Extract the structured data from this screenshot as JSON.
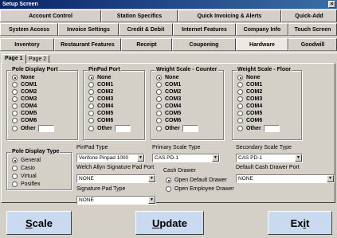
{
  "window": {
    "title": "Setup Screen",
    "close_label": "×"
  },
  "tabs": {
    "row1": [
      "Account Control",
      "Station Specifics",
      "Quick Invoicing & Alerts",
      "Quick-Add"
    ],
    "row2": [
      "System Access",
      "Invoice Settings",
      "Credit & Debit",
      "Internet Features",
      "Company Info",
      "Touch Screen"
    ],
    "row3": [
      "Inventory",
      "Restaurant Features",
      "Receipt",
      "Couponing",
      "Hardware",
      "Goodwill"
    ],
    "active": "Hardware"
  },
  "subtabs": [
    "Page 1",
    "Page 2"
  ],
  "groups": {
    "pole_display_port": {
      "title": "Pole Display Port",
      "options": [
        "None",
        "COM1",
        "COM2",
        "COM3",
        "COM4",
        "COM5",
        "COM6",
        "Other"
      ],
      "selected": "None"
    },
    "pinpad_port": {
      "title": "PinPad Port",
      "options": [
        "None",
        "COM1",
        "COM2",
        "COM3",
        "COM4",
        "COM5",
        "COM6",
        "Other"
      ],
      "selected": "None"
    },
    "weight_scale_counter": {
      "title": "Weight Scale - Counter",
      "options": [
        "None",
        "COM1",
        "COM2",
        "COM3",
        "COM4",
        "COM5",
        "COM6",
        "Other"
      ],
      "selected": "None"
    },
    "weight_scale_floor": {
      "title": "Weight Scale - Floor",
      "options": [
        "None",
        "COM1",
        "COM2",
        "COM3",
        "COM4",
        "COM5",
        "COM6",
        "Other"
      ],
      "selected": "None"
    },
    "pole_display_type": {
      "title": "Pole Display Type",
      "options": [
        "General",
        "Casio",
        "Virtual",
        "Posiflex"
      ],
      "selected": "General"
    },
    "cash_drawer": {
      "title": "Cash Drawer",
      "options": [
        "Open Default Drawer",
        "Open Employee Drawer"
      ],
      "selected": "Open Default Drawer"
    }
  },
  "fields": {
    "pinpad_type": {
      "label": "PinPad Type",
      "value": "Verifone Pinpad 1000"
    },
    "welch_allyn_port": {
      "label": "Welch Allyn Signature Pad Port",
      "value": "NONE"
    },
    "signature_pad_type": {
      "label": "Signature Pad Type",
      "value": "NONE"
    },
    "primary_scale_type": {
      "label": "Primary Scale Type",
      "value": "CAS PD-1"
    },
    "secondary_scale_type": {
      "label": "Secondary Scale Type",
      "value": "CAS PD-1"
    },
    "default_cash_drawer_port": {
      "label": "Default Cash Drawer Port",
      "value": "NONE"
    }
  },
  "buttons": {
    "scale": {
      "first": "S",
      "rest": "cale"
    },
    "update": {
      "first": "U",
      "rest": "pdate"
    },
    "exit": {
      "first": "Ex",
      "mid": "i",
      "rest": "t"
    }
  }
}
